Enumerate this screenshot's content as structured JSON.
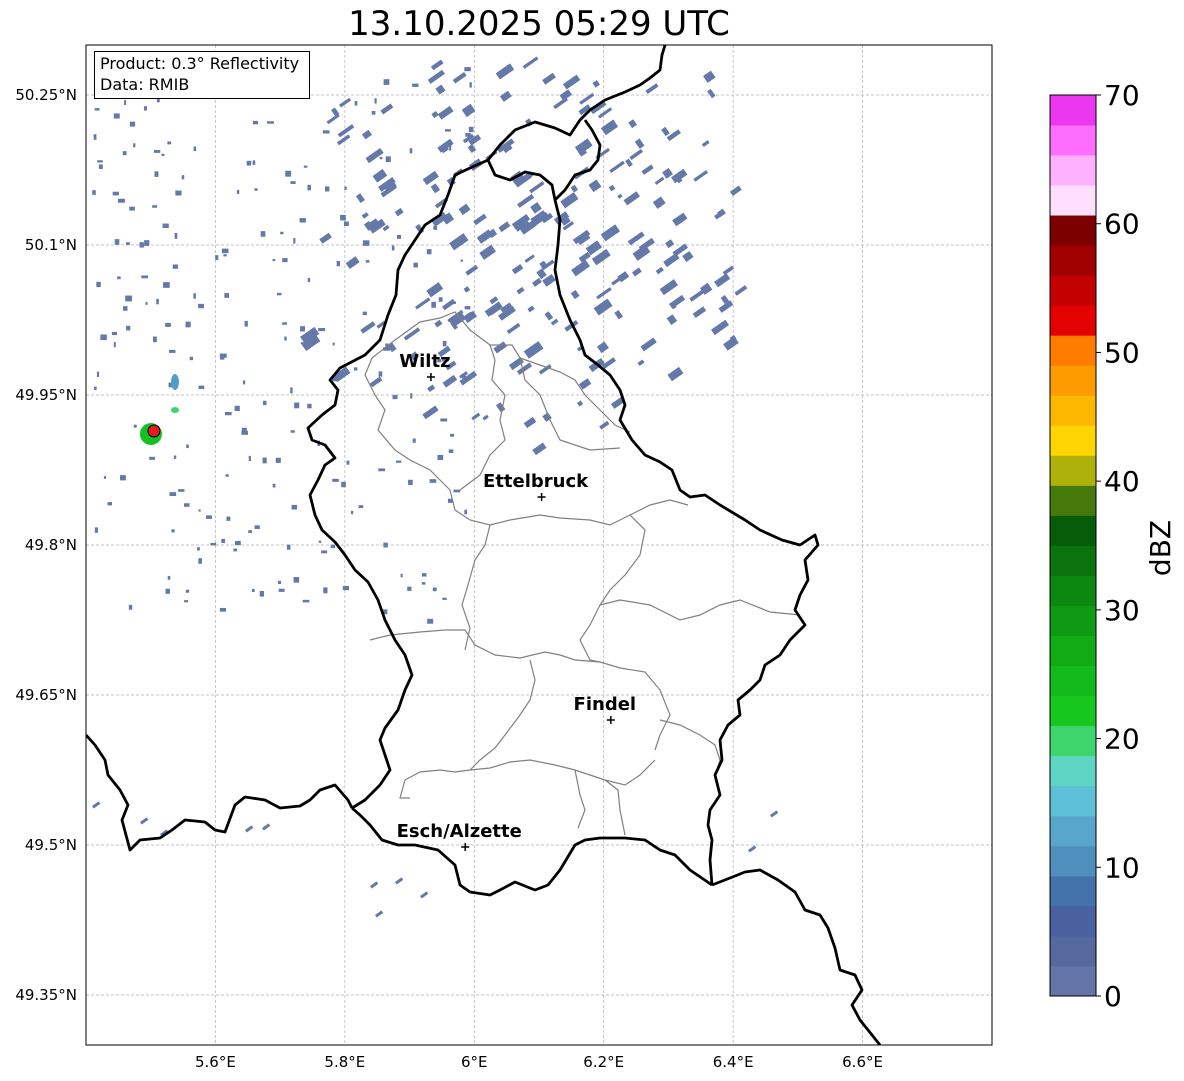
{
  "title": "13.10.2025 05:29 UTC",
  "info": {
    "product": "Product: 0.3° Reflectivity",
    "data": "Data: RMIB"
  },
  "map": {
    "lon_range": [
      5.4,
      6.8
    ],
    "lat_range": [
      49.3,
      50.3
    ],
    "x_ticks": [
      {
        "value": 5.6,
        "label": "5.6°E"
      },
      {
        "value": 5.8,
        "label": "5.8°E"
      },
      {
        "value": 6.0,
        "label": "6°E"
      },
      {
        "value": 6.2,
        "label": "6.2°E"
      },
      {
        "value": 6.4,
        "label": "6.4°E"
      },
      {
        "value": 6.6,
        "label": "6.6°E"
      }
    ],
    "y_ticks": [
      {
        "value": 50.25,
        "label": "50.25°N"
      },
      {
        "value": 50.1,
        "label": "50.1°N"
      },
      {
        "value": 49.95,
        "label": "49.95°N"
      },
      {
        "value": 49.8,
        "label": "49.8°N"
      },
      {
        "value": 49.65,
        "label": "49.65°N"
      },
      {
        "value": 49.5,
        "label": "49.5°N"
      },
      {
        "value": 49.35,
        "label": "49.35°N"
      }
    ],
    "cities": [
      {
        "name": "Wiltz",
        "lon": 5.933,
        "lat": 49.968
      },
      {
        "name": "Ettelbruck",
        "lon": 6.104,
        "lat": 49.848
      },
      {
        "name": "Findel",
        "lon": 6.211,
        "lat": 49.625
      },
      {
        "name": "Esch/Alzette",
        "lon": 5.986,
        "lat": 49.498
      }
    ],
    "radar_site": {
      "lon": 5.505,
      "lat": 49.914
    }
  },
  "colorbar": {
    "label": "dBZ",
    "min": 0,
    "max": 70,
    "ticks": [
      0,
      10,
      20,
      30,
      40,
      50,
      60,
      70
    ],
    "colors": [
      "#6474a6",
      "#55699e",
      "#4a61a0",
      "#4472ab",
      "#4e8fbd",
      "#59a6cb",
      "#5ec0d6",
      "#5fd6c5",
      "#3dd56c",
      "#16c81e",
      "#12bb1b",
      "#11ab16",
      "#0f9a14",
      "#0c8811",
      "#0a730e",
      "#075c0a",
      "#457a0b",
      "#adb10a",
      "#fed500",
      "#fdb701",
      "#fe9b01",
      "#fe7c00",
      "#e40101",
      "#c40101",
      "#a10000",
      "#7c0000",
      "#fee0fe",
      "#feb2fe",
      "#fe6efe",
      "#eb37ef"
    ]
  }
}
